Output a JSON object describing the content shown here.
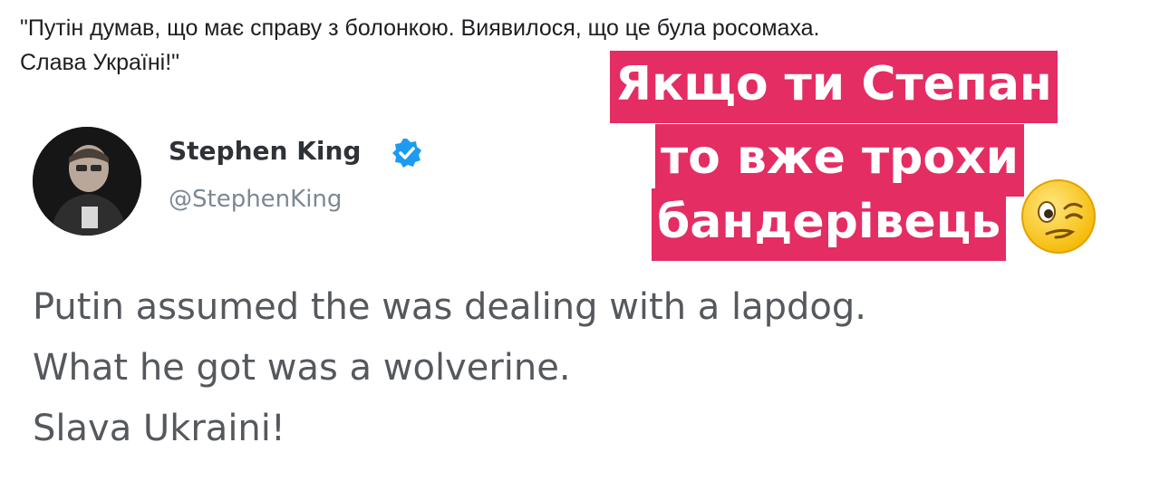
{
  "caption": {
    "line1": "\"Путін думав, що має справу з болонкою. Виявилося, що це була росомаха.",
    "line2": "Слава Україні!\""
  },
  "tweet": {
    "author_name": "Stephen King",
    "author_handle": "@StephenKing",
    "verified": true,
    "lines": [
      "Putin assumed the was dealing with a lapdog.",
      "What he got was a wolverine.",
      "Slava Ukraini!"
    ]
  },
  "sticker": {
    "lines": [
      "Якщо ти Степан",
      "то вже трохи",
      "бандерівець"
    ],
    "background_color": "#e42d63",
    "text_color": "#ffffff",
    "emoji": "winking-face-emoji"
  },
  "colors": {
    "verified_badge": "#1d9bf0",
    "tweet_text": "#55585c",
    "handle": "#7c8894"
  }
}
